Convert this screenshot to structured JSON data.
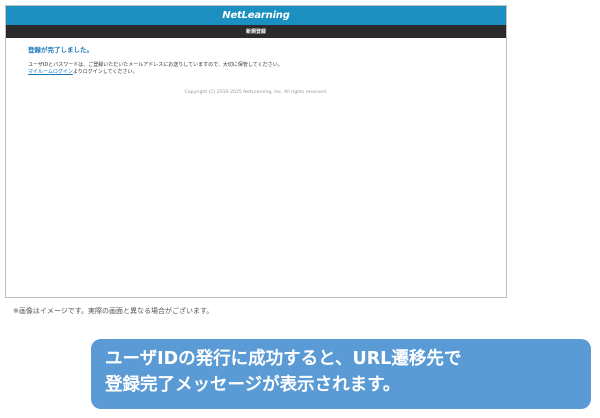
{
  "brand": {
    "logo_text": "NetLearning",
    "header_color": "#1a8fc0",
    "subbar_color": "#2b2b2b"
  },
  "subbar": {
    "title": "新規登録"
  },
  "main": {
    "done_message": "登録が完了しました。",
    "line1": "ユーザIDとパスワードは、ご登録いただいたメールアドレスにお送りしていますので、大切に保管してください。",
    "link_text": "マイルームログイン",
    "line2_rest": "よりログインしてください。",
    "copyright": "Copyright (C) 2010-2025 NetLearning, Inc. All rights reserved."
  },
  "note": "※画像はイメージです。実際の画面と異なる場合がございます。",
  "callout": {
    "line1": "ユーザIDの発行に成功すると、URL遷移先で",
    "line2": "登録完了メッセージが表示されます。",
    "color": "#5b9bd5"
  }
}
